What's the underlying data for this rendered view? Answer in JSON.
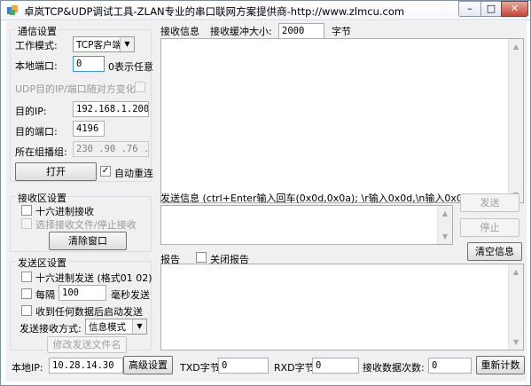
{
  "window": {
    "title": "卓岚TCP&UDP调试工具-ZLAN专业的串口联网方案提供商-http://www.zlmcu.com",
    "min_label": "–",
    "max_label": "□",
    "close_label": "✕"
  },
  "comm": {
    "group_title": "通信设置",
    "mode_label": "工作模式:",
    "mode_value": "TCP客户端",
    "local_port_label": "本地端口:",
    "local_port_value": "0",
    "local_port_hint": "0表示任意",
    "udp_dest_label": "UDP目的IP/端口随对方变化",
    "dest_ip_label": "目的IP:",
    "dest_ip_value": "192.168.1.200",
    "dest_port_label": "目的端口:",
    "dest_port_value": "4196",
    "multicast_label": "所在组播组:",
    "multicast_value": "230 .90 .76 .1",
    "open_button": "打开",
    "auto_reconnect_label": "自动重连"
  },
  "recv_settings": {
    "group_title": "接收区设置",
    "hex_recv_label": "十六进制接收",
    "select_file_label": "选择接收文件/停止接收",
    "clear_button": "清除窗口"
  },
  "send_settings": {
    "group_title": "发送区设置",
    "hex_send_label": "十六进制发送 (格式01 02)",
    "every_label": "每隔",
    "interval_value": "100",
    "ms_send_label": "毫秒发送",
    "auto_send_label": "收到任何数据后启动发送",
    "method_label": "发送接收方式:",
    "method_value": "信息模式",
    "modify_filename_button": "修改发送文件名"
  },
  "recv_area": {
    "label": "接收信息",
    "buffer_label": "接收缓冲大小:",
    "buffer_value": "2000",
    "unit_label": "字节"
  },
  "send_area": {
    "label": "发送信息 (ctrl+Enter输入回车(0x0d,0x0a); \\r输入0x0d,\\n输入0x0a)",
    "send_button": "发送",
    "stop_button": "停止"
  },
  "report": {
    "label": "报告",
    "close_report_label": "关闭报告",
    "clear_info_button": "清空信息"
  },
  "statusbar": {
    "local_ip_label": "本地IP:",
    "local_ip_value": "10.28.14.30",
    "advanced_button": "高级设置",
    "txd_label": "TXD字节:",
    "txd_value": "0",
    "rxd_label": "RXD字节:",
    "rxd_value": "0",
    "recv_count_label": "接收数据次数:",
    "recv_count_value": "0",
    "recount_button": "重新计数"
  },
  "icons": {
    "app": "app-logo-icon",
    "dropdown": "chevron-down-icon",
    "scroll_up": "scroll-up-icon",
    "scroll_down": "scroll-down-icon",
    "check": "checkmark-icon"
  }
}
